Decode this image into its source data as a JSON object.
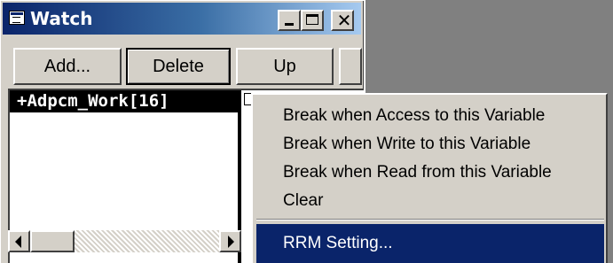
{
  "window": {
    "title": "Watch",
    "close_glyph": "✕",
    "icons": {
      "system": "watch-window-icon",
      "minimize": "minimize-icon",
      "maximize": "maximize-icon",
      "close": "close-icon"
    }
  },
  "toolbar": {
    "add_label": "Add...",
    "delete_label": "Delete",
    "up_label": "Up"
  },
  "watch_list": {
    "rows": [
      {
        "name": "+Adpcm_Work[16]",
        "selected": true
      }
    ]
  },
  "context_menu": {
    "items": [
      {
        "label": "Break when Access to this Variable",
        "highlighted": false
      },
      {
        "label": "Break when Write to this Variable",
        "highlighted": false
      },
      {
        "label": "Break when Read from this Variable",
        "highlighted": false
      },
      {
        "label": "Clear",
        "highlighted": false
      },
      {
        "label": "RRM Setting...",
        "highlighted": true
      }
    ]
  },
  "colors": {
    "title_bar_start": "#0a246a",
    "title_bar_end": "#a6caf0",
    "face": "#d4d0c8",
    "highlight": "#0a246a",
    "desktop": "#808080"
  }
}
